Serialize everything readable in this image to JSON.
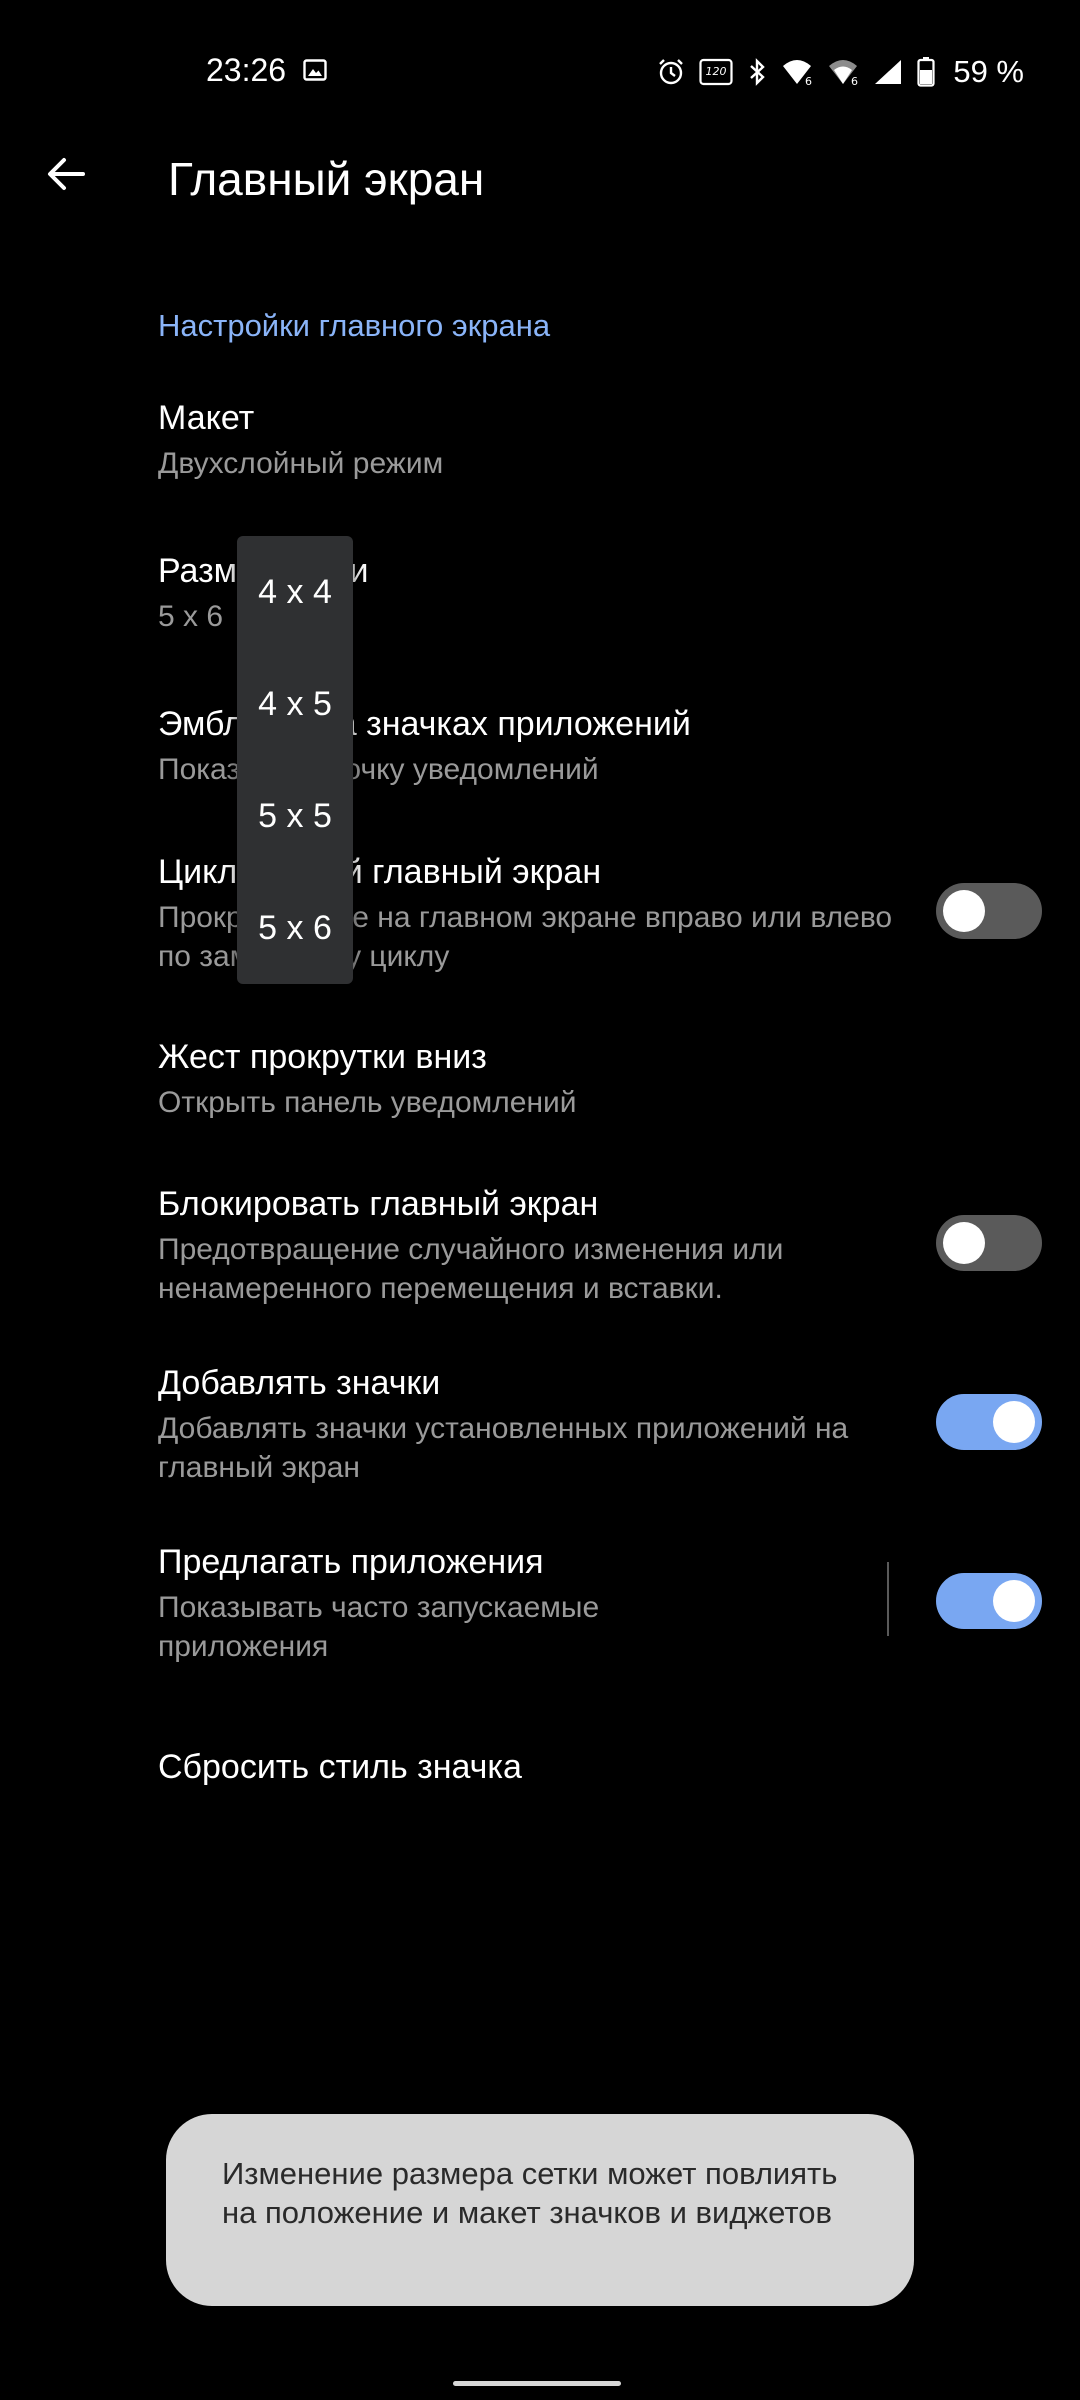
{
  "status_bar": {
    "time": "23:26",
    "battery_percent": "59 %",
    "refresh_rate_badge": "120",
    "icons": [
      "image-icon",
      "alarm-icon",
      "refresh-rate-icon",
      "bluetooth-icon",
      "wifi-6-icon",
      "wifi-6-icon",
      "signal-icon",
      "battery-icon"
    ]
  },
  "app_bar": {
    "title": "Главный экран",
    "back_icon": "arrow-left-icon"
  },
  "section": {
    "header": "Настройки главного экрана"
  },
  "settings": [
    {
      "title": "Макет",
      "summary": "Двухслойный режим"
    },
    {
      "title": "Размер сетки",
      "summary": "5 x 6"
    },
    {
      "title": "Эмблемы на значках приложений",
      "summary": "Показывать точку уведомлений"
    },
    {
      "title": "Циклический главный экран",
      "summary": "Прокручивайте на главном экране вправо или влево по замкнутому циклу",
      "toggle": false
    },
    {
      "title": "Жест прокрутки вниз",
      "summary": "Открыть панель уведомлений"
    },
    {
      "title": "Блокировать главный экран",
      "summary": "Предотвращение случайного изменения или ненамеренного перемещения и вставки.",
      "toggle": false
    },
    {
      "title": "Добавлять значки",
      "summary": "Добавлять значки установленных приложений на главный экран",
      "toggle": true
    },
    {
      "title": "Предлагать приложения",
      "summary": "Показывать часто запускаемые приложения",
      "toggle": true
    },
    {
      "title": "Сбросить стиль значка"
    }
  ],
  "grid_menu": {
    "options": [
      "4 x 4",
      "4 x 5",
      "5 x 5",
      "5 x 6"
    ]
  },
  "toast": {
    "text": "Изменение размера сетки может повлиять на положение и макет значков и виджетов"
  },
  "colors": {
    "background": "#000000",
    "accent": "#8ab4f8",
    "toggle_on": "#79a7f2",
    "toggle_off": "#5a5a5a",
    "popup": "#2f3032",
    "toast": "#d6d6d6"
  }
}
